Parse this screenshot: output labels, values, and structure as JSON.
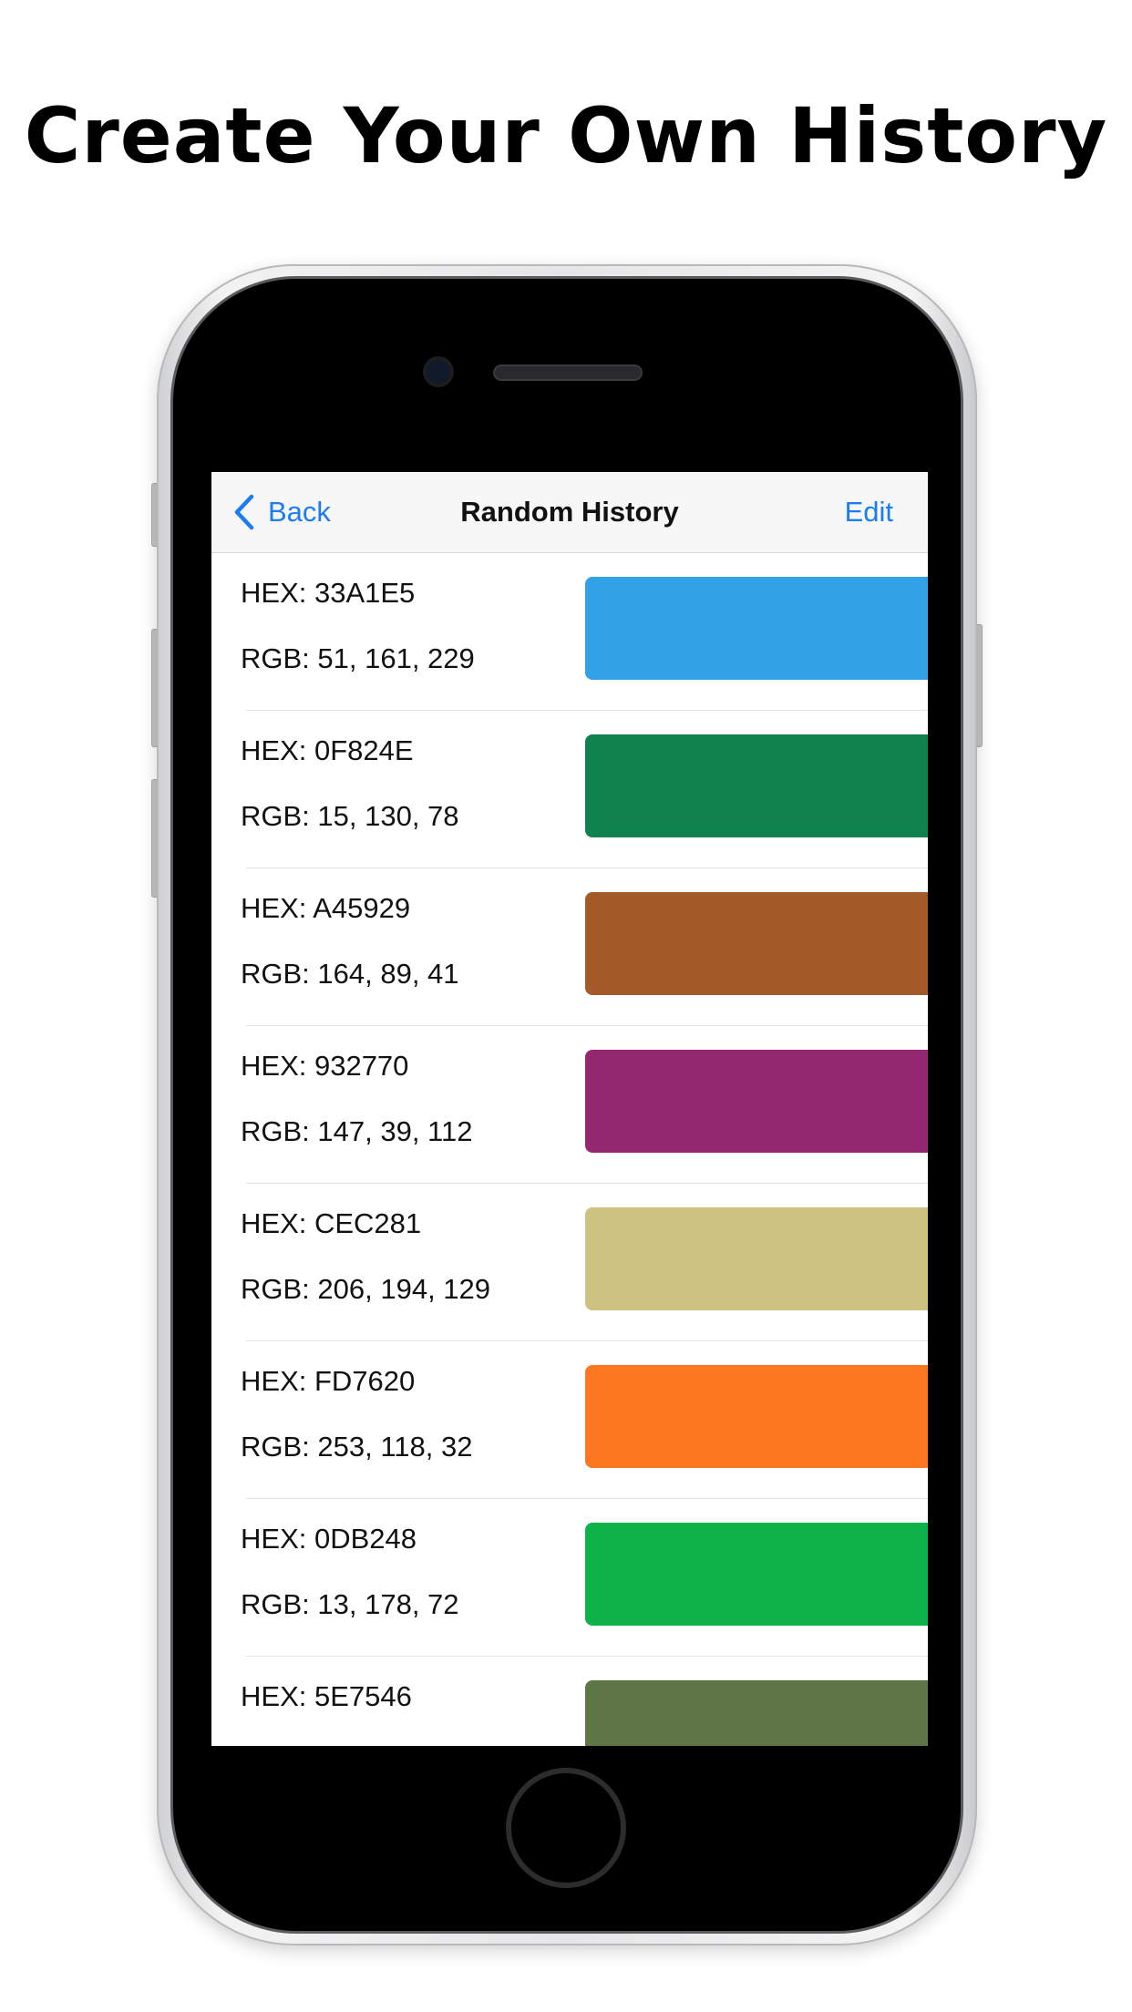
{
  "headline": "Create Your Own History",
  "navbar": {
    "back_label": "Back",
    "title": "Random History",
    "edit_label": "Edit"
  },
  "colors": {
    "accent": "#1B7CF4"
  },
  "history": [
    {
      "hex": "HEX: 33A1E5",
      "rgb": "RGB: 51, 161, 229",
      "swatch": "#33A1E5"
    },
    {
      "hex": "HEX: 0F824E",
      "rgb": "RGB: 15, 130, 78",
      "swatch": "#0F824E"
    },
    {
      "hex": "HEX: A45929",
      "rgb": "RGB: 164, 89, 41",
      "swatch": "#A45929"
    },
    {
      "hex": "HEX: 932770",
      "rgb": "RGB: 147, 39, 112",
      "swatch": "#932770"
    },
    {
      "hex": "HEX: CEC281",
      "rgb": "RGB: 206, 194, 129",
      "swatch": "#CEC281"
    },
    {
      "hex": "HEX: FD7620",
      "rgb": "RGB: 253, 118, 32",
      "swatch": "#FD7620"
    },
    {
      "hex": "HEX: 0DB248",
      "rgb": "RGB: 13, 178, 72",
      "swatch": "#0DB248"
    },
    {
      "hex": "HEX: 5E7546",
      "rgb": "",
      "swatch": "#5E7546"
    }
  ]
}
